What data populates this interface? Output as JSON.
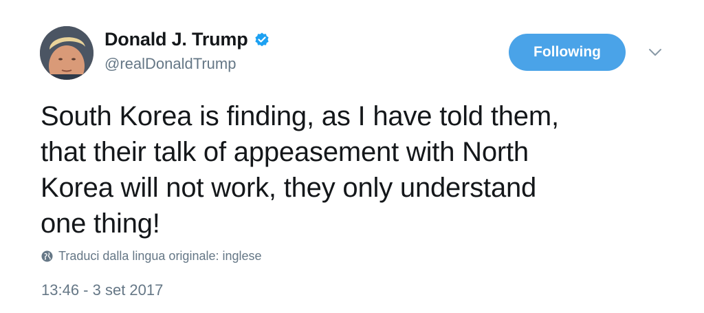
{
  "author": {
    "name": "Donald J. Trump",
    "handle": "@realDonaldTrump",
    "verified_icon": "verified-badge-icon",
    "avatar_icon": "profile-photo"
  },
  "actions": {
    "follow_label": "Following",
    "menu_icon": "chevron-down-icon"
  },
  "tweet": {
    "lines": [
      "South Korea is finding, as I have told them,",
      "that their talk of appeasement with North",
      "Korea will not work, they only understand",
      "one thing!"
    ],
    "translate_label": "Traduci dalla lingua originale: inglese",
    "timestamp": "13:46 - 3 set 2017"
  },
  "colors": {
    "accent": "#4aa3e8",
    "verified": "#1da1f2",
    "secondary_text": "#657786",
    "primary_text": "#14171a"
  }
}
